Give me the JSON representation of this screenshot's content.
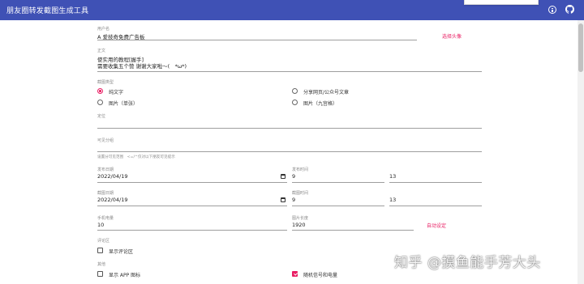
{
  "app": {
    "title": "朋友圈转发截图生成工具"
  },
  "fields": {
    "user_name": {
      "label": "用户名",
      "value": "A 爱技奇免费广告板",
      "action": "选择头像"
    },
    "content": {
      "label": "正文",
      "line1": "使实用的教程[握手]",
      "line2": "需要收集五个赞 谢谢大家啦～(　*ω*)"
    },
    "share_type": {
      "label": "截图类型",
      "options": [
        {
          "label": "纯文字",
          "selected": true
        },
        {
          "label": "分享网页/公众号文章",
          "selected": false
        },
        {
          "label": "图片（单张）",
          "selected": false
        },
        {
          "label": "图片（九宫格）",
          "selected": false
        }
      ]
    },
    "location": {
      "label": "定位",
      "value": ""
    },
    "visible_to": {
      "label": "可见分组",
      "value": "",
      "hint": "设置分可见范围　<=/^仅对以下朋友可见提示"
    },
    "post_date": {
      "label": "发布日期",
      "value": "2022/04/19"
    },
    "post_time": {
      "label": "发布时间",
      "hour": "9",
      "minute": "13"
    },
    "shot_date": {
      "label": "截图日期",
      "value": "2022/04/19"
    },
    "shot_time": {
      "label": "截图时间",
      "hour": "9",
      "minute": "13"
    },
    "battery": {
      "label": "手机电量",
      "value": "10"
    },
    "screen_height": {
      "label": "图片长度",
      "value": "1920",
      "action": "自动设定"
    },
    "comments": {
      "label": "评论区",
      "option": "显示评论区"
    },
    "other": {
      "label": "其他",
      "option_app": "显示 APP 图标",
      "option_signal": "随机信号和电量"
    }
  },
  "watermark": "知乎 @摸鱼能手芳大头"
}
